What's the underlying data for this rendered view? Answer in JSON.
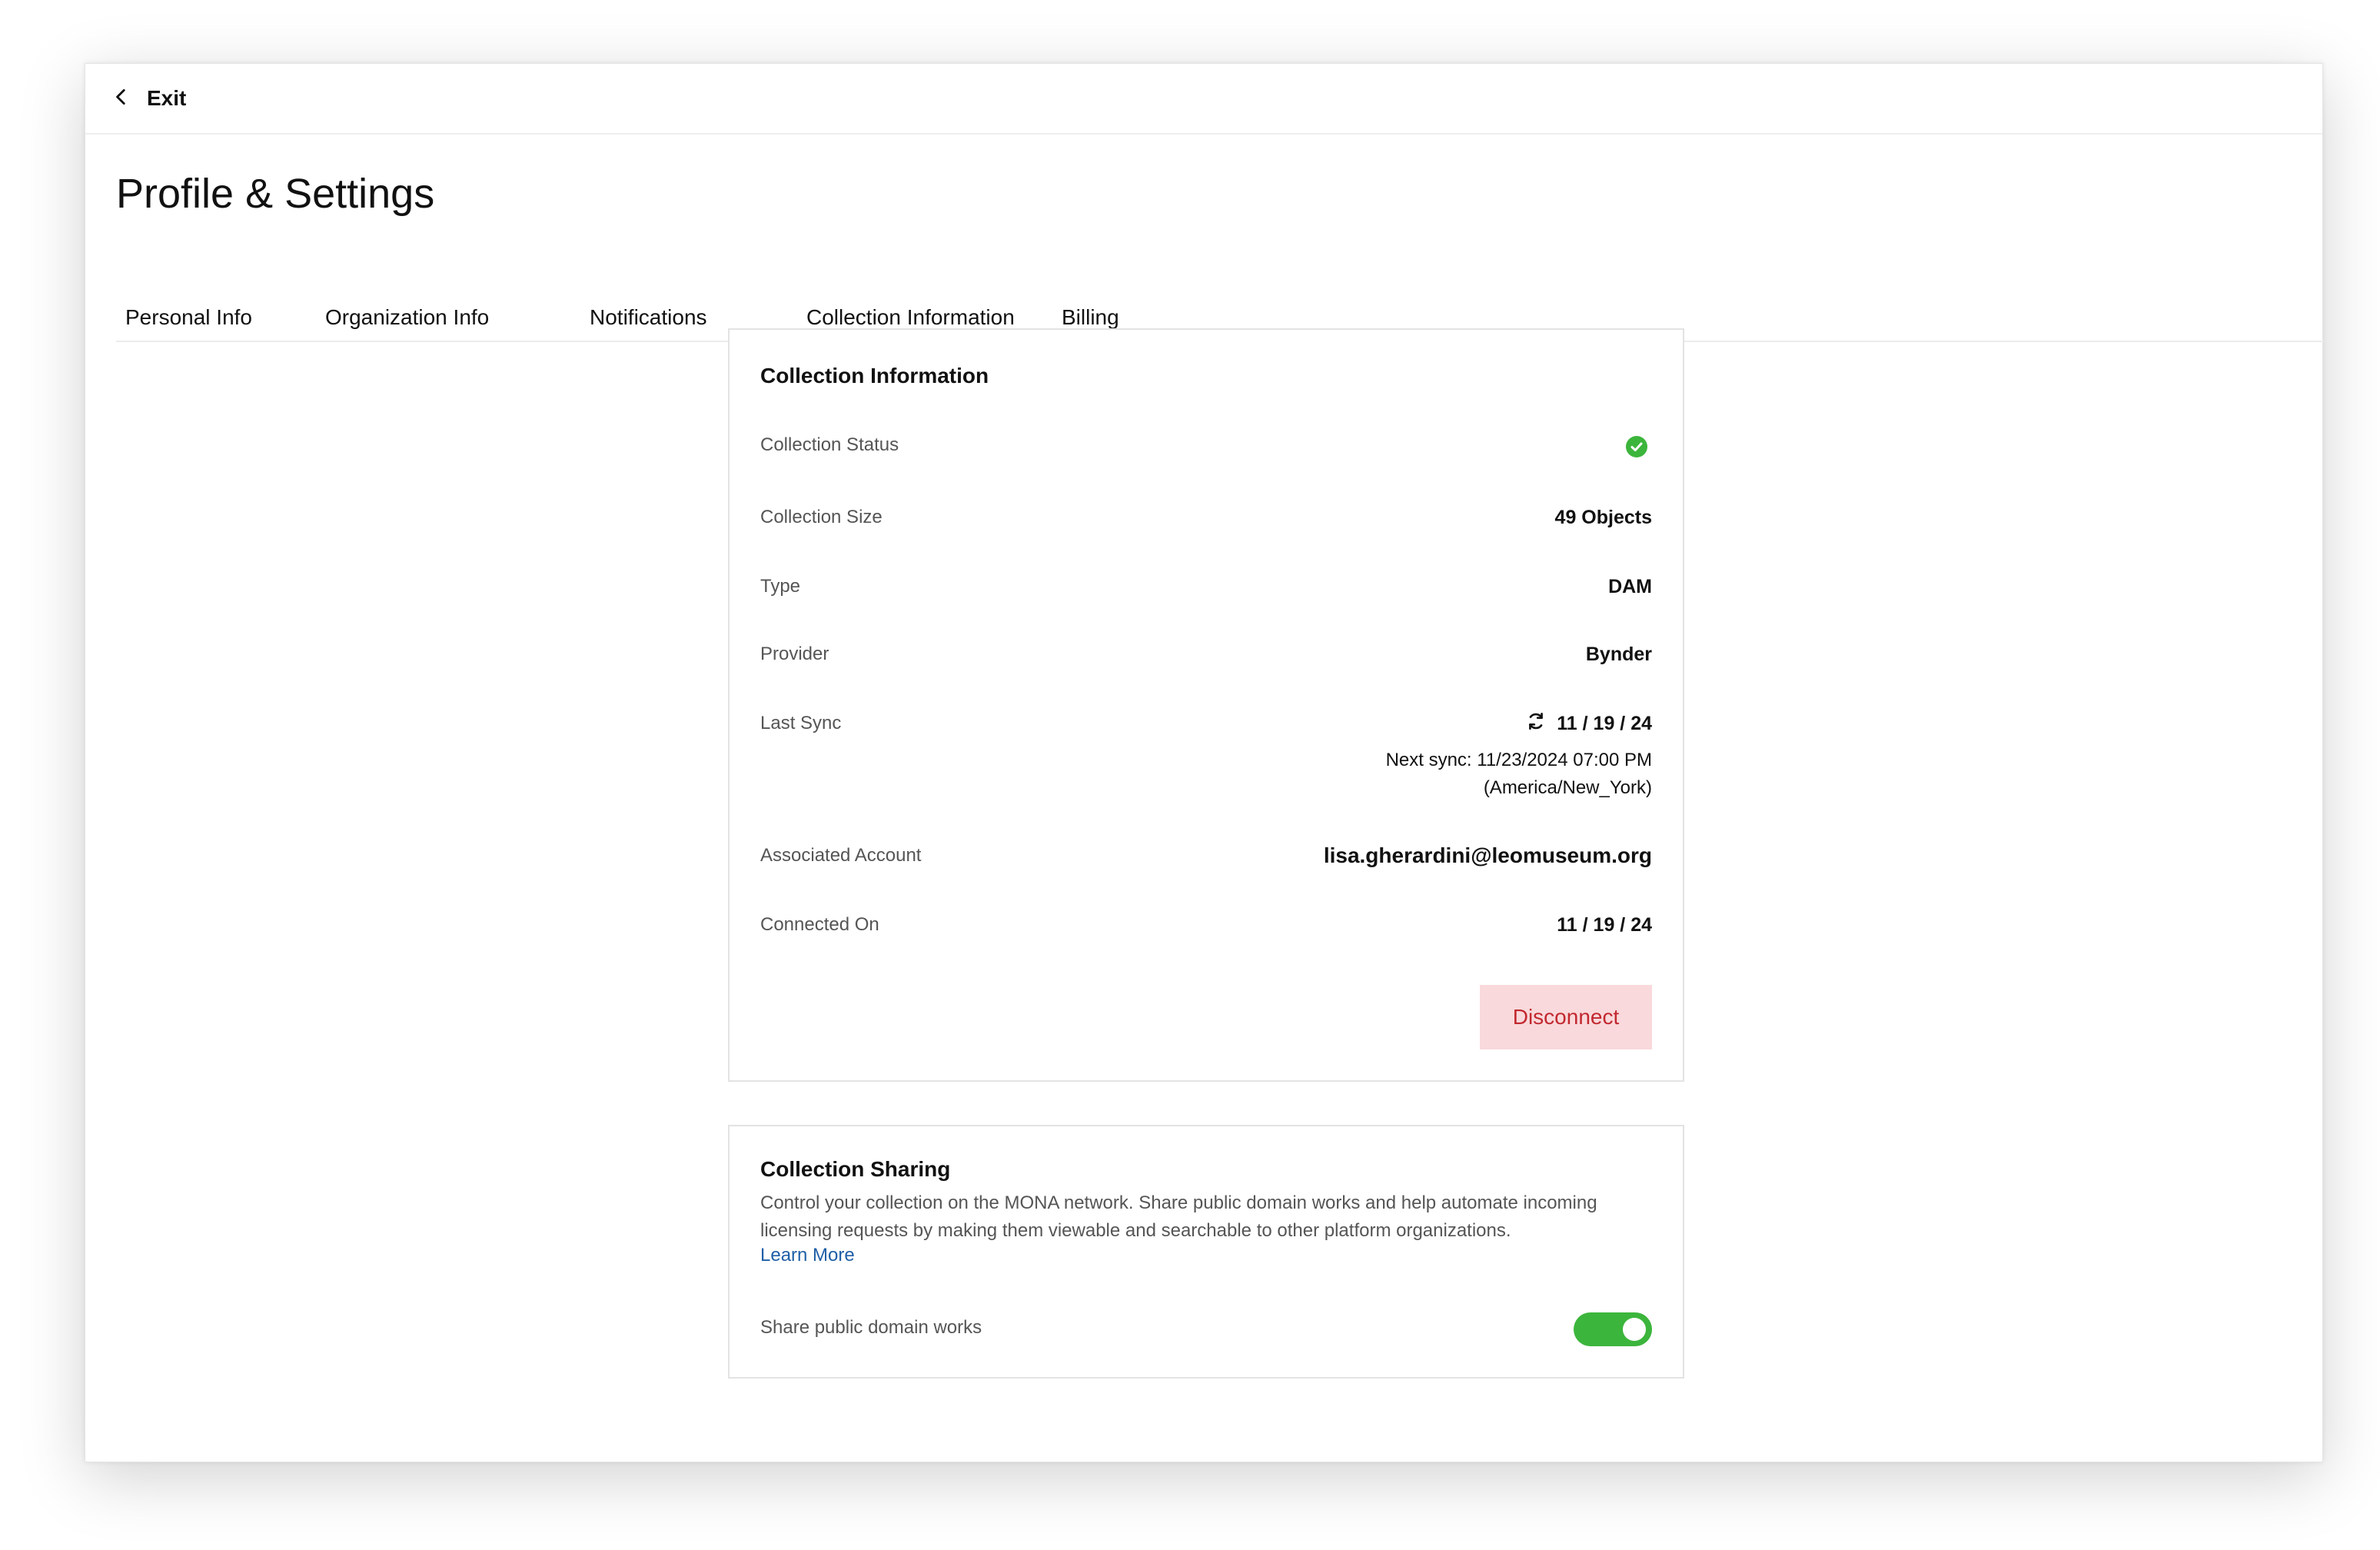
{
  "header": {
    "exit_label": "Exit"
  },
  "page": {
    "title": "Profile & Settings"
  },
  "tabs": [
    {
      "label": "Personal Info"
    },
    {
      "label": "Organization Info"
    },
    {
      "label": "Notifications"
    },
    {
      "label": "Collection Information",
      "active": true
    },
    {
      "label": "Billing"
    }
  ],
  "collection_info": {
    "title": "Collection Information",
    "status_label": "Collection Status",
    "status_icon": "check-circle-icon",
    "status_color": "#3cb53c",
    "size_label": "Collection Size",
    "size_value": "49 Objects",
    "type_label": "Type",
    "type_value": "DAM",
    "provider_label": "Provider",
    "provider_value": "Bynder",
    "last_sync_label": "Last Sync",
    "last_sync_icon": "sync-icon",
    "last_sync_value": "11 / 19 / 24",
    "next_sync_line1": "Next sync: 11/23/2024 07:00 PM",
    "next_sync_line2": "(America/New_York)",
    "account_label": "Associated Account",
    "account_value": "lisa.gherardini@leomuseum.org",
    "connected_label": "Connected On",
    "connected_value": "11 / 19 / 24",
    "disconnect_label": "Disconnect"
  },
  "collection_sharing": {
    "title": "Collection Sharing",
    "description": "Control your collection on the MONA network. Share public domain works and help automate incoming licensing requests by making them viewable and searchable to other platform organizations.",
    "learn_more": "Learn More",
    "toggle_label": "Share public domain works",
    "toggle_on": true,
    "toggle_color": "#3cb53c"
  }
}
